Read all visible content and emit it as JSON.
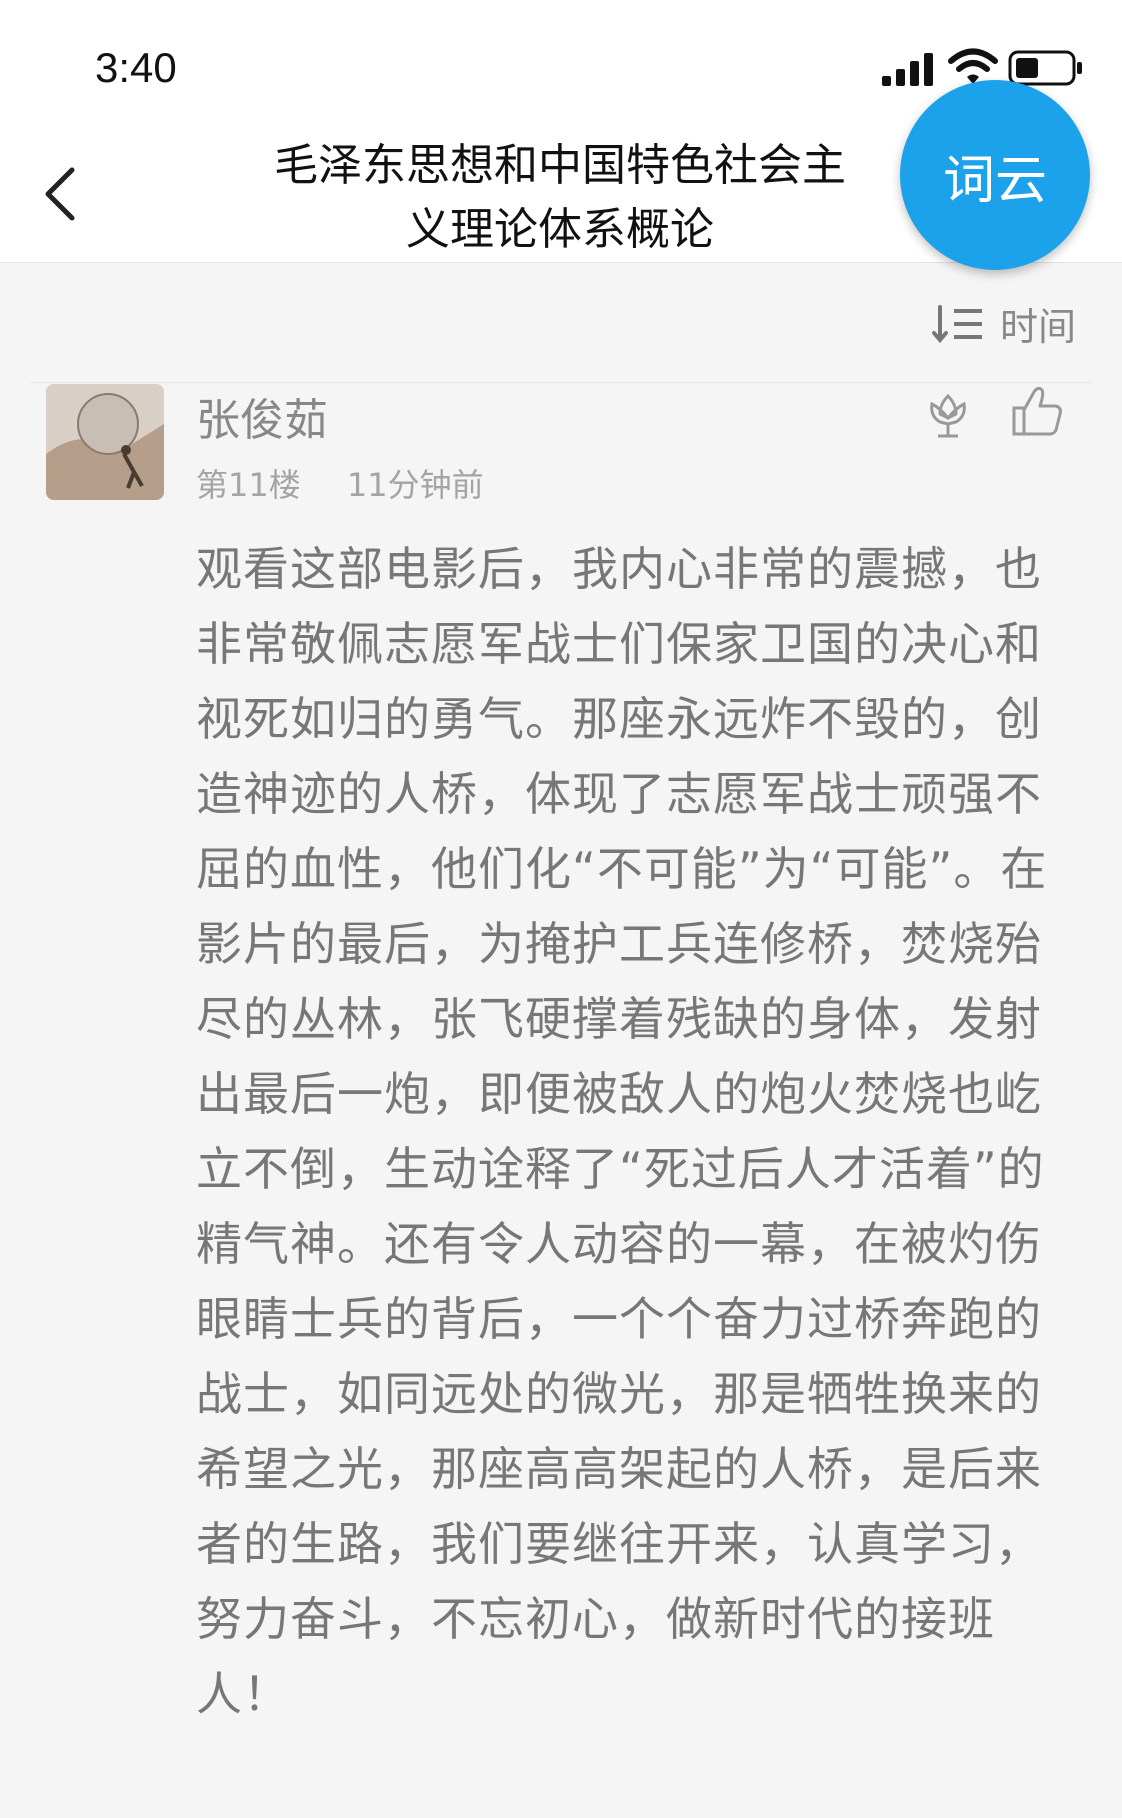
{
  "status_bar": {
    "time": "3:40"
  },
  "nav": {
    "title": "毛泽东思想和中国特色社会主义理论体系概论",
    "word_cloud_label": "词云"
  },
  "sort": {
    "label": "时间"
  },
  "comment": {
    "author": "张俊茹",
    "floor": "第11楼",
    "time_ago": "11分钟前",
    "body": "观看这部电影后，我内心非常的震撼，也非常敬佩志愿军战士们保家卫国的决心和视死如归的勇气。那座永远炸不毁的，创造神迹的人桥，体现了志愿军战士顽强不屈的血性，他们化“不可能”为“可能”。在影片的最后，为掩护工兵连修桥，焚烧殆尽的丛林，张飞硬撑着残缺的身体，发射出最后一炮，即便被敌人的炮火焚烧也屹立不倒，生动诠释了“死过后人才活着”的精气神。还有令人动容的一幕，在被灼伤眼睛士兵的背后，一个个奋力过桥奔跑的战士，如同远处的微光，那是牺牲换来的希望之光，那座高高架起的人桥，是后来者的生路，我们要继往开来，认真学习，努力奋斗，不忘初心，做新时代的接班人！"
  },
  "icons": {
    "back": "chevron-left-icon",
    "sort": "sort-descending-icon",
    "flower": "flower-icon",
    "like": "thumbs-up-icon",
    "signal": "cellular-signal-icon",
    "wifi": "wifi-icon",
    "battery": "battery-icon"
  },
  "colors": {
    "accent": "#1ba2ea",
    "background": "#f5f5f5",
    "text_secondary": "#888888"
  }
}
